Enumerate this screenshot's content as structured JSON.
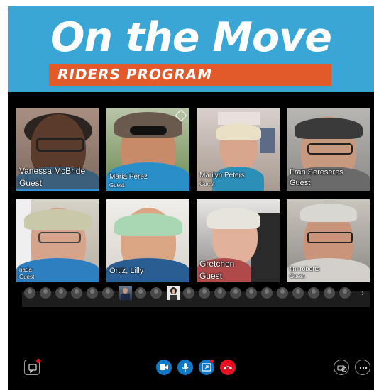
{
  "banner": {
    "title": "On the Move",
    "subtitle": "RIDERS PROGRAM"
  },
  "participants": [
    {
      "name": "Vanessa McBride",
      "role": "Guest",
      "speaking": true
    },
    {
      "name": "Maria Perez",
      "role": "Guest"
    },
    {
      "name": "Marilyn Peters",
      "role": "Guest"
    },
    {
      "name": "Fran Sereseres",
      "role": "Guest"
    },
    {
      "name": "nada",
      "role": "Guest"
    },
    {
      "name": "Ortiz, Lilly",
      "role": ""
    },
    {
      "name": "Gretchen",
      "role": "Guest"
    },
    {
      "name": "tim roberts",
      "role": "Guest"
    }
  ],
  "controls": {
    "chat": "chat-icon",
    "video": "video-icon",
    "mic": "microphone-icon",
    "share": "share-screen-icon",
    "hangup": "hang-up-icon",
    "devices": "devices-icon",
    "more": "more-icon"
  },
  "colors": {
    "banner_blue": "#3aa6d6",
    "banner_orange": "#e2592a",
    "control_blue": "#0f78c8",
    "hangup_red": "#e81123"
  }
}
